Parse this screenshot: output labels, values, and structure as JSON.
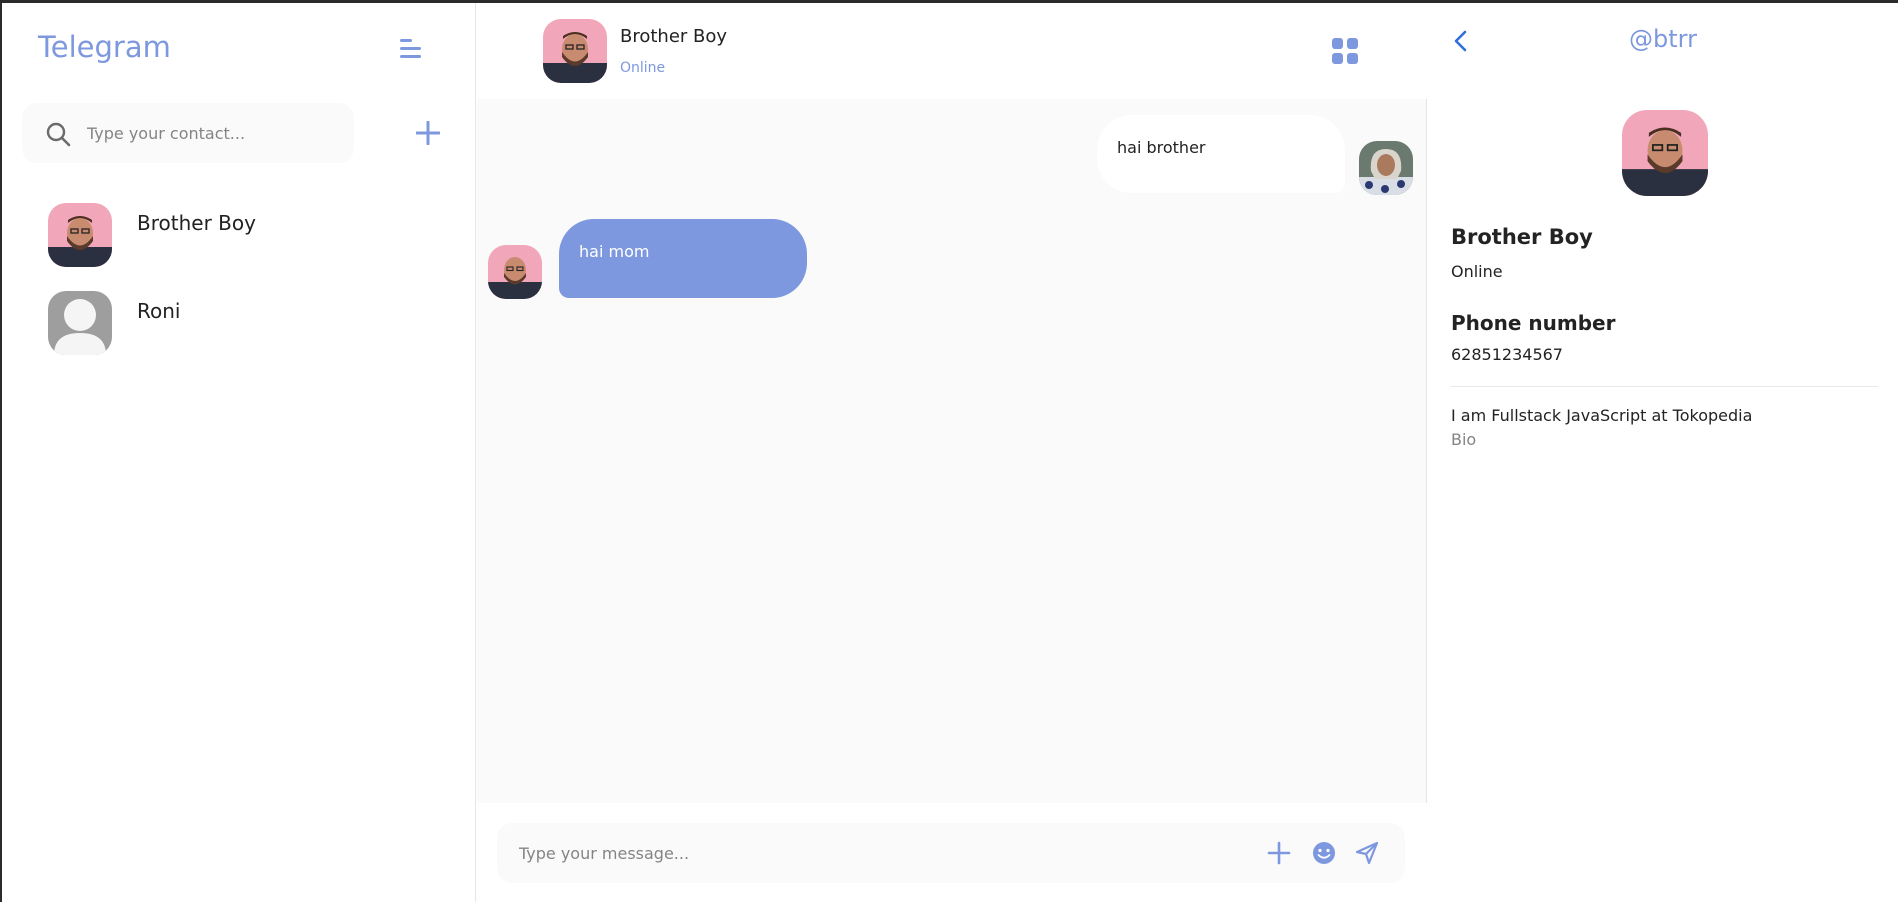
{
  "app": {
    "title": "Telegram"
  },
  "sidebar": {
    "search_placeholder": "Type your contact...",
    "contacts": [
      {
        "name": "Brother Boy"
      },
      {
        "name": "Roni"
      }
    ]
  },
  "chat": {
    "header": {
      "name": "Brother Boy",
      "status": "Online"
    },
    "messages": [
      {
        "direction": "outgoing",
        "text": "hai brother"
      },
      {
        "direction": "incoming",
        "text": "hai mom"
      }
    ],
    "compose_placeholder": "Type your message..."
  },
  "profile": {
    "handle": "@btrr",
    "name": "Brother Boy",
    "status": "Online",
    "phone_label": "Phone number",
    "phone": "62851234567",
    "bio": "I am Fullstack JavaScript at Tokopedia",
    "bio_label": "Bio"
  },
  "colors": {
    "accent": "#7e98df",
    "background": "#fafafa"
  },
  "icons": [
    "menu-icon",
    "search-icon",
    "plus-icon",
    "grid-icon",
    "emoji-icon",
    "send-icon",
    "back-icon"
  ]
}
